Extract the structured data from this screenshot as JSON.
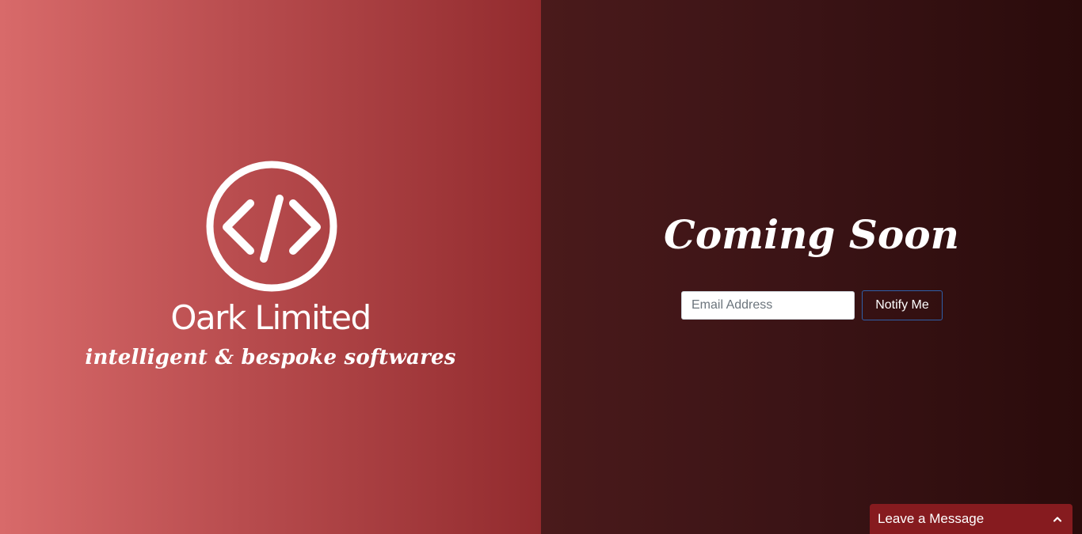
{
  "colors": {
    "left_gradient_start": "#d86a6a",
    "left_gradient_end": "#922b2e",
    "right_gradient_start": "#4a1a1b",
    "right_gradient_end": "#2a0b0b",
    "button_border": "#2f5fa8",
    "chat_background": "#861b1f",
    "text": "#ffffff"
  },
  "brand": {
    "logo_icon": "code-brackets-icon",
    "name": "Oark Limited",
    "tagline": "intelligent & bespoke softwares"
  },
  "main": {
    "heading": "Coming Soon",
    "email_placeholder": "Email Address",
    "notify_label": "Notify Me"
  },
  "chat": {
    "label": "Leave a Message",
    "toggle_icon": "chevron-up-icon"
  }
}
